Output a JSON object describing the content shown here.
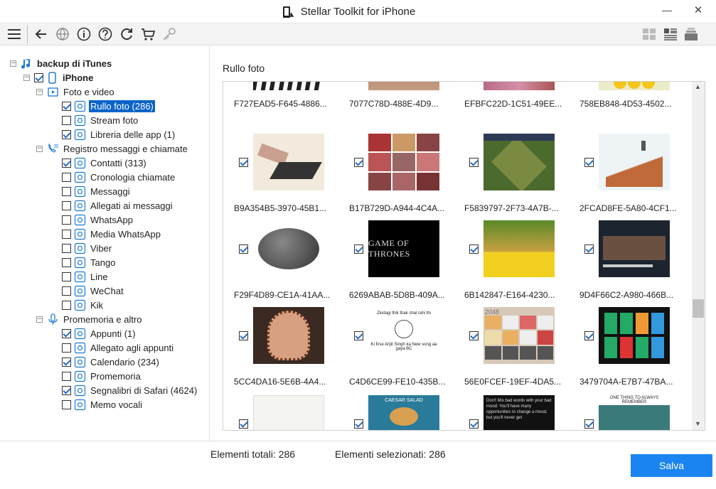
{
  "window": {
    "title": "Stellar Toolkit for iPhone",
    "minimize": "—",
    "close": "✕"
  },
  "toolbar": {
    "icons": [
      "menu-icon",
      "back-icon",
      "globe-icon",
      "info-icon",
      "help-icon",
      "refresh-icon",
      "cart-icon",
      "key-icon"
    ],
    "view_icons": [
      "grid-view-icon",
      "list-view-icon",
      "layers-view-icon"
    ]
  },
  "tree": [
    {
      "label": "backup di iTunes",
      "level": 0,
      "bold": true,
      "expander": "−",
      "checkbox": null,
      "icon": "music-icon",
      "selected": false
    },
    {
      "label": "iPhone",
      "level": 1,
      "bold": true,
      "expander": "−",
      "checkbox": true,
      "icon": "phone-icon",
      "selected": false
    },
    {
      "label": "Foto e video",
      "level": 2,
      "bold": false,
      "expander": "−",
      "checkbox": null,
      "icon": "photo-video-icon",
      "selected": false
    },
    {
      "label": "Rullo foto (286)",
      "level": 3,
      "bold": false,
      "expander": null,
      "checkbox": true,
      "icon": "flower-icon",
      "selected": true
    },
    {
      "label": "Stream foto",
      "level": 3,
      "bold": false,
      "expander": null,
      "checkbox": false,
      "icon": "stream-icon",
      "selected": false
    },
    {
      "label": "Libreria delle app (1)",
      "level": 3,
      "bold": false,
      "expander": null,
      "checkbox": true,
      "icon": "app-library-icon",
      "selected": false
    },
    {
      "label": "Registro messaggi e chiamate",
      "level": 2,
      "bold": false,
      "expander": "−",
      "checkbox": null,
      "icon": "call-log-icon",
      "selected": false
    },
    {
      "label": "Contatti (313)",
      "level": 3,
      "bold": false,
      "expander": null,
      "checkbox": true,
      "icon": "contacts-icon",
      "selected": false
    },
    {
      "label": "Cronologia chiamate",
      "level": 3,
      "bold": false,
      "expander": null,
      "checkbox": false,
      "icon": "call-history-icon",
      "selected": false
    },
    {
      "label": "Messaggi",
      "level": 3,
      "bold": false,
      "expander": null,
      "checkbox": false,
      "icon": "messages-icon",
      "selected": false
    },
    {
      "label": "Allegati ai messaggi",
      "level": 3,
      "bold": false,
      "expander": null,
      "checkbox": false,
      "icon": "attachment-icon",
      "selected": false
    },
    {
      "label": "WhatsApp",
      "level": 3,
      "bold": false,
      "expander": null,
      "checkbox": false,
      "icon": "whatsapp-icon",
      "selected": false
    },
    {
      "label": "Media WhatsApp",
      "level": 3,
      "bold": false,
      "expander": null,
      "checkbox": false,
      "icon": "whatsapp-media-icon",
      "selected": false
    },
    {
      "label": "Viber",
      "level": 3,
      "bold": false,
      "expander": null,
      "checkbox": false,
      "icon": "viber-icon",
      "selected": false
    },
    {
      "label": "Tango",
      "level": 3,
      "bold": false,
      "expander": null,
      "checkbox": false,
      "icon": "tango-icon",
      "selected": false
    },
    {
      "label": "Line",
      "level": 3,
      "bold": false,
      "expander": null,
      "checkbox": false,
      "icon": "line-icon",
      "selected": false
    },
    {
      "label": "WeChat",
      "level": 3,
      "bold": false,
      "expander": null,
      "checkbox": false,
      "icon": "wechat-icon",
      "selected": false
    },
    {
      "label": "Kik",
      "level": 3,
      "bold": false,
      "expander": null,
      "checkbox": false,
      "icon": "kik-icon",
      "selected": false
    },
    {
      "label": "Promemoria e altro",
      "level": 2,
      "bold": false,
      "expander": "−",
      "checkbox": null,
      "icon": "microphone-icon",
      "selected": false
    },
    {
      "label": "Appunti  (1)",
      "level": 3,
      "bold": false,
      "expander": null,
      "checkbox": true,
      "icon": "notes-icon",
      "selected": false
    },
    {
      "label": "Allegato agli appunti",
      "level": 3,
      "bold": false,
      "expander": null,
      "checkbox": false,
      "icon": "notes-attachment-icon",
      "selected": false
    },
    {
      "label": "Calendario (234)",
      "level": 3,
      "bold": false,
      "expander": null,
      "checkbox": true,
      "icon": "calendar-icon",
      "selected": false
    },
    {
      "label": "Promemoria",
      "level": 3,
      "bold": false,
      "expander": null,
      "checkbox": false,
      "icon": "reminders-icon",
      "selected": false
    },
    {
      "label": "Segnalibri di Safari (4624)",
      "level": 3,
      "bold": false,
      "expander": null,
      "checkbox": true,
      "icon": "safari-icon",
      "selected": false
    },
    {
      "label": "Memo vocali",
      "level": 3,
      "bold": false,
      "expander": null,
      "checkbox": false,
      "icon": "voice-memo-icon",
      "selected": false
    }
  ],
  "content": {
    "title": "Rullo foto"
  },
  "photos": [
    {
      "name": "F727EAD5-F645-4886...",
      "checked": true,
      "thumb": "silhouettes"
    },
    {
      "name": "7077C78D-488E-4D9...",
      "checked": true,
      "thumb": "brown"
    },
    {
      "name": "EFBFC22D-1C51-49EE...",
      "checked": true,
      "thumb": "pink"
    },
    {
      "name": "758EB848-4D53-4502...",
      "checked": true,
      "thumb": "emoji"
    },
    {
      "name": "B9A354B5-3970-45B1...",
      "checked": true,
      "thumb": "shadow-art"
    },
    {
      "name": "B17B729D-A944-4C4A...",
      "checked": true,
      "thumb": "collage"
    },
    {
      "name": "F5839797-2F73-4A7B-...",
      "checked": true,
      "thumb": "game-map"
    },
    {
      "name": "2FCAD8FE-5A80-4CF1...",
      "checked": true,
      "thumb": "stairs"
    },
    {
      "name": "F29F4D89-CE1A-41AA...",
      "checked": true,
      "thumb": "mouse"
    },
    {
      "name": "6269ABAB-5D8B-409A...",
      "checked": true,
      "thumb": "game-of-thrones"
    },
    {
      "name": "6B142847-E164-4230...",
      "checked": true,
      "thumb": "greeting"
    },
    {
      "name": "9D4F66C2-A980-466B...",
      "checked": true,
      "thumb": "news"
    },
    {
      "name": "5CC4DA16-5E6B-4A4...",
      "checked": true,
      "thumb": "henna"
    },
    {
      "name": "C4D6CE99-FE10-435B...",
      "checked": true,
      "thumb": "meme"
    },
    {
      "name": "56E0FCEF-19EF-4DA5...",
      "checked": true,
      "thumb": "game-2048"
    },
    {
      "name": "3479704A-E7B7-47BA...",
      "checked": true,
      "thumb": "phone-home"
    },
    {
      "name": "",
      "checked": true,
      "thumb": "sketch"
    },
    {
      "name": "",
      "checked": true,
      "thumb": "food-ad"
    },
    {
      "name": "",
      "checked": true,
      "thumb": "quote-dark"
    },
    {
      "name": "",
      "checked": true,
      "thumb": "one-thing"
    }
  ],
  "thumb_text": {
    "got": "GAME OF THRONES",
    "meme_top": "Zindagi thik thak chal rahi thi",
    "meme_bottom": "Ki firse Arijit Singh ka New song aa gaya BC",
    "g2048": "2048",
    "food": "CAESAR SALAD",
    "quote": "Don't Mix bad words with your bad mood. You'll have many opportunities to change a mood, but you'll never get",
    "onething": "ONE THING TO ALWAYS REMEMBER"
  },
  "footer": {
    "total_label": "Elementi totali: 286",
    "selected_label": "Elementi selezionati: 286",
    "save_label": "Salva"
  }
}
